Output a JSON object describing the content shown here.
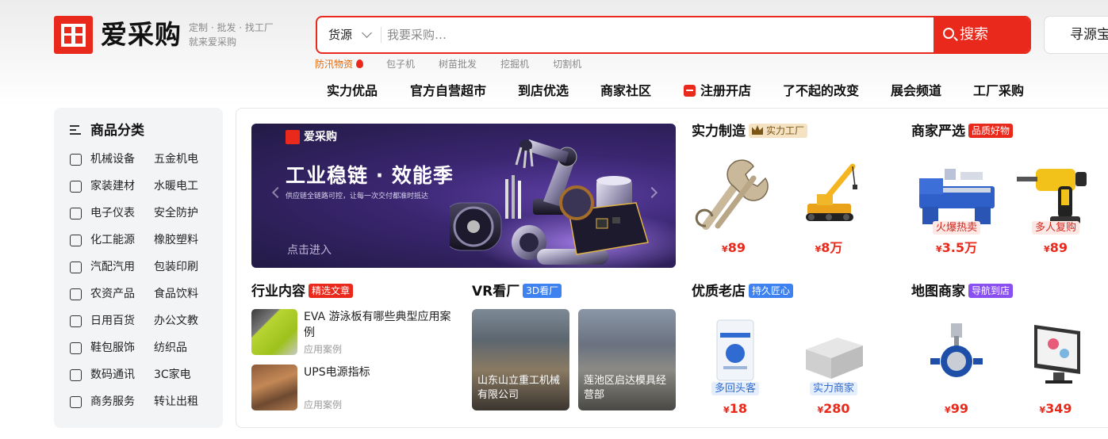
{
  "logo": {
    "name": "爱采购",
    "tagline1": "定制 · 批发 · 找工厂",
    "tagline2": "就来爱采购"
  },
  "search": {
    "type_label": "货源",
    "placeholder": "我要采购…",
    "button_label": "搜索",
    "source_button": "寻源宝"
  },
  "hot_words": [
    "防汛物资",
    "包子机",
    "树苗批发",
    "挖掘机",
    "切割机"
  ],
  "top_nav": [
    "实力优品",
    "官方自营超市",
    "到店优选",
    "商家社区",
    "注册开店",
    "了不起的改变",
    "展会频道",
    "工厂采购"
  ],
  "sidebar": {
    "title": "商品分类",
    "rows": [
      [
        "机械设备",
        "五金机电"
      ],
      [
        "家装建材",
        "水暖电工"
      ],
      [
        "电子仪表",
        "安全防护"
      ],
      [
        "化工能源",
        "橡胶塑料"
      ],
      [
        "汽配汽用",
        "包装印刷"
      ],
      [
        "农资产品",
        "食品饮料"
      ],
      [
        "日用百货",
        "办公文教"
      ],
      [
        "鞋包服饰",
        "纺织品"
      ],
      [
        "数码通讯",
        "3C家电"
      ],
      [
        "商务服务",
        "转让出租"
      ]
    ],
    "icons": [
      "machine-icon",
      "paint-roller-icon",
      "signal-icon",
      "flask-icon",
      "car-icon",
      "apple-icon",
      "cup-icon",
      "shirt-icon",
      "laptop-icon",
      "briefcase-icon"
    ]
  },
  "banner": {
    "logo": "爱采购",
    "title": "工业稳链 · 效能季",
    "subtitle": "供应链全链路可控，让每一次交付都准时抵达",
    "cta": "点击进入"
  },
  "sections": {
    "strength": {
      "title": "实力制造",
      "tag": "实力工厂",
      "products": [
        {
          "price": "89",
          "unit": ""
        },
        {
          "price": "8",
          "unit": "万"
        }
      ]
    },
    "merchant": {
      "title": "商家严选",
      "tag": "品质好物",
      "products": [
        {
          "price": "3.5",
          "unit": "万",
          "badge": "火爆热卖"
        },
        {
          "price": "89",
          "unit": "",
          "badge": "多人复购"
        }
      ]
    },
    "industry": {
      "title": "行业内容",
      "tag": "精选文章",
      "articles": [
        {
          "title": "EVA 游泳板有哪些典型应用案例",
          "category": "应用案例"
        },
        {
          "title": "UPS电源指标",
          "category": "应用案例"
        }
      ]
    },
    "vr": {
      "title": "VR看厂",
      "tag": "3D看厂",
      "factories": [
        "山东山立重工机械有限公司",
        "莲池区启达模具经营部"
      ]
    },
    "old_store": {
      "title": "优质老店",
      "tag": "持久匠心",
      "products": [
        {
          "price": "18",
          "badge": "多回头客"
        },
        {
          "price": "280",
          "badge": "实力商家"
        }
      ]
    },
    "map": {
      "title": "地图商家",
      "tag": "导航到店",
      "products": [
        {
          "price": "99"
        },
        {
          "price": "349"
        }
      ]
    }
  },
  "currency": "¥",
  "colors": {
    "brand_red": "#e8291c",
    "price_red": "#e8291c",
    "tag_blue": "#3d82f0",
    "tag_purple": "#8a4ff0",
    "gold": "#f4e2c2"
  }
}
